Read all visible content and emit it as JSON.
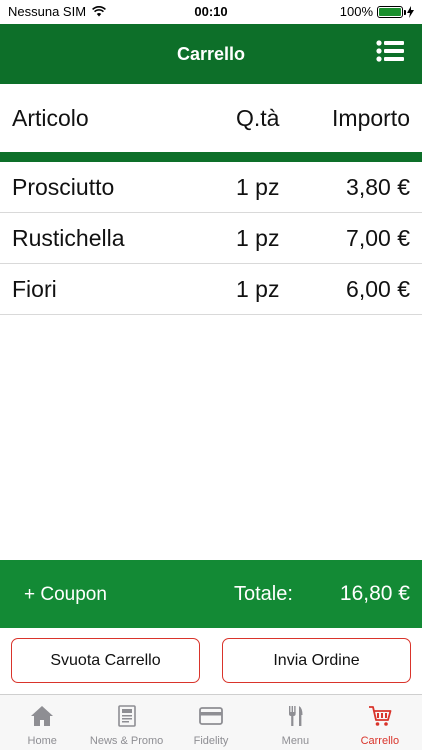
{
  "status": {
    "carrier": "Nessuna SIM",
    "time": "00:10",
    "battery": "100%"
  },
  "nav": {
    "title": "Carrello"
  },
  "table": {
    "headers": {
      "name": "Articolo",
      "qty": "Q.tà",
      "amount": "Importo"
    },
    "rows": [
      {
        "name": "Prosciutto",
        "qty": "1 pz",
        "amount": "3,80 €"
      },
      {
        "name": "Rustichella",
        "qty": "1 pz",
        "amount": "7,00 €"
      },
      {
        "name": "Fiori",
        "qty": "1 pz",
        "amount": "6,00 €"
      }
    ]
  },
  "footer": {
    "coupon": "+ Coupon",
    "total_label": "Totale:",
    "total_value": "16,80 €"
  },
  "actions": {
    "empty_cart": "Svuota Carrello",
    "send_order": "Invia Ordine"
  },
  "tabs": [
    {
      "label": "Home",
      "icon": "home-icon"
    },
    {
      "label": "News & Promo",
      "icon": "news-icon"
    },
    {
      "label": "Fidelity",
      "icon": "card-icon"
    },
    {
      "label": "Menu",
      "icon": "cutlery-icon"
    },
    {
      "label": "Carrello",
      "icon": "cart-icon"
    }
  ],
  "colors": {
    "primary_green": "#0d6f29",
    "footer_green": "#138a35",
    "accent_red": "#d9342b",
    "inactive_gray": "#8e8e93"
  }
}
